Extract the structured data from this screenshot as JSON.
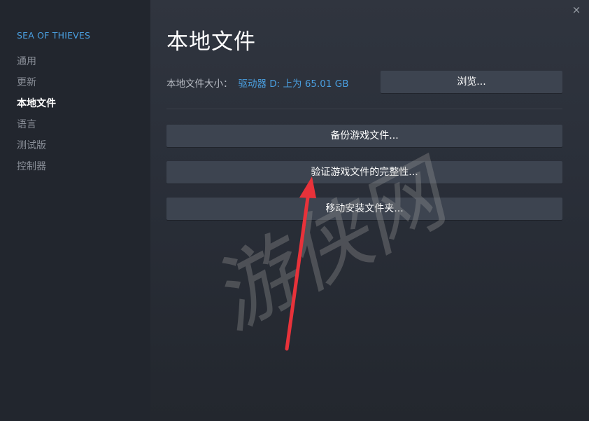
{
  "window": {
    "accent_color": "#2a7fb0",
    "close_label": "×"
  },
  "sidebar": {
    "game_title": "SEA OF THIEVES",
    "items": [
      {
        "label": "通用",
        "active": false
      },
      {
        "label": "更新",
        "active": false
      },
      {
        "label": "本地文件",
        "active": true
      },
      {
        "label": "语言",
        "active": false
      },
      {
        "label": "测试版",
        "active": false
      },
      {
        "label": "控制器",
        "active": false
      }
    ]
  },
  "main": {
    "title": "本地文件",
    "size_label": "本地文件大小：",
    "size_value": "驱动器 D: 上为 65.01 GB",
    "browse_label": "浏览...",
    "backup_label": "备份游戏文件...",
    "verify_label": "验证游戏文件的完整性...",
    "move_label": "移动安装文件夹..."
  },
  "overlay": {
    "arrow_color": "#e8323a",
    "watermark_text": "游侠网"
  }
}
